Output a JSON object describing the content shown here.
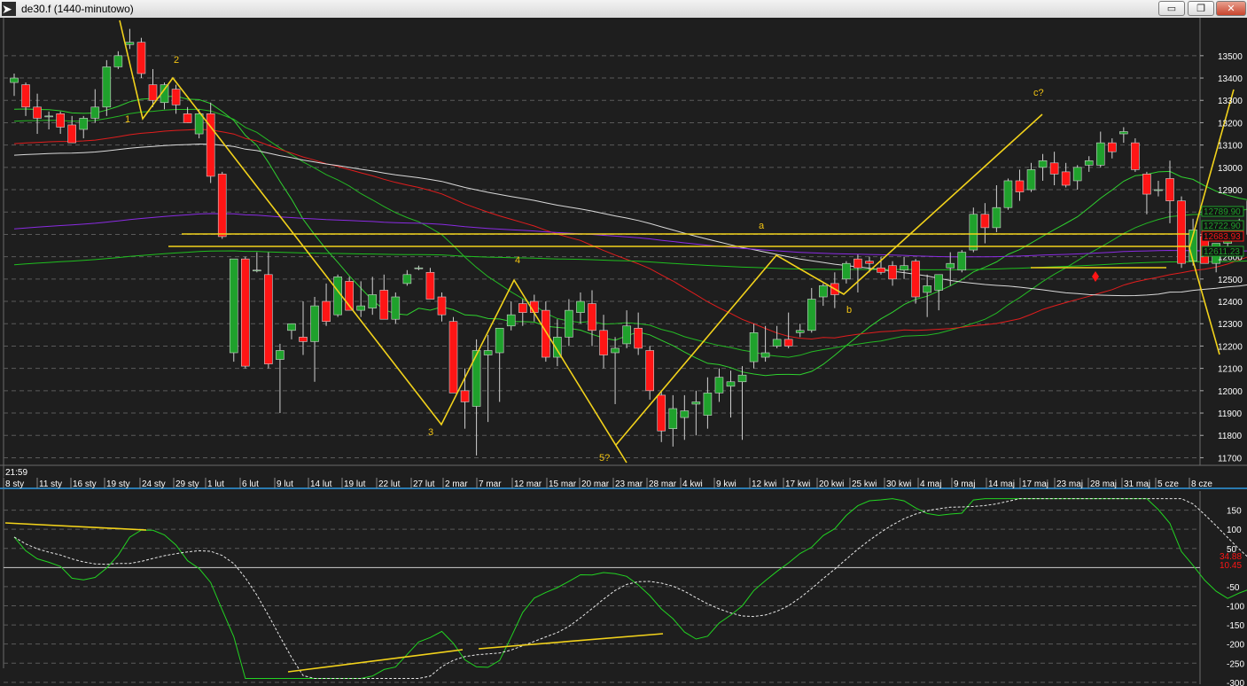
{
  "window": {
    "title": "de30.f (1440-minutowo)",
    "minimize_label": "▭",
    "restore_label": "❐",
    "close_label": "✕"
  },
  "time_label": "21:59",
  "colors": {
    "background": "#1e1e1e",
    "bull_candle": "#1fa12c",
    "bear_candle": "#ff1515",
    "annotation": "#f2d21b",
    "grid": "#5a5a5a"
  },
  "chart_data": [
    {
      "type": "candlestick",
      "symbol": "de30.f",
      "ylim": [
        11670,
        13670
      ],
      "y_ticks": [
        11700,
        11800,
        11900,
        12000,
        12100,
        12200,
        12300,
        12400,
        12500,
        12600,
        12700,
        12800,
        12900,
        13000,
        13100,
        13200,
        13300,
        13400,
        13500
      ],
      "y_tick_labels": [
        "11700",
        "11800",
        "11900",
        "12000",
        "12100",
        "12200",
        "12300",
        "12400",
        "12500",
        "12600",
        "12700",
        "12800",
        "12900",
        "13000",
        "13100",
        "13200",
        "13300",
        "13400",
        "13500"
      ],
      "x_tick_labels": [
        "8 sty",
        "11 sty",
        "16 sty",
        "19 sty",
        "24 sty",
        "29 sty",
        "1 lut",
        "6 lut",
        "9 lut",
        "14 lut",
        "19 lut",
        "22 lut",
        "27 lut",
        "2 mar",
        "7 mar",
        "12 mar",
        "15 mar",
        "20 mar",
        "23 mar",
        "28 mar",
        "4 kwi",
        "9 kwi",
        "12 kwi",
        "17 kwi",
        "20 kwi",
        "25 kwi",
        "30 kwi",
        "4 maj",
        "9 maj",
        "14 maj",
        "17 maj",
        "23 maj",
        "28 maj",
        "31 maj",
        "5 cze",
        "8 cze"
      ],
      "candles": [
        {
          "o": 13380,
          "h": 13420,
          "l": 13320,
          "c": 13400
        },
        {
          "o": 13370,
          "h": 13380,
          "l": 13230,
          "c": 13270
        },
        {
          "o": 13270,
          "h": 13330,
          "l": 13150,
          "c": 13220
        },
        {
          "o": 13230,
          "h": 13250,
          "l": 13170,
          "c": 13230
        },
        {
          "o": 13240,
          "h": 13250,
          "l": 13150,
          "c": 13180
        },
        {
          "o": 13190,
          "h": 13230,
          "l": 13110,
          "c": 13110
        },
        {
          "o": 13170,
          "h": 13230,
          "l": 13130,
          "c": 13220
        },
        {
          "o": 13220,
          "h": 13350,
          "l": 13200,
          "c": 13270
        },
        {
          "o": 13270,
          "h": 13480,
          "l": 13230,
          "c": 13450
        },
        {
          "o": 13450,
          "h": 13520,
          "l": 13440,
          "c": 13500
        },
        {
          "o": 13550,
          "h": 13620,
          "l": 13530,
          "c": 13560
        },
        {
          "o": 13560,
          "h": 13580,
          "l": 13400,
          "c": 13420
        },
        {
          "o": 13370,
          "h": 13440,
          "l": 13270,
          "c": 13300
        },
        {
          "o": 13290,
          "h": 13380,
          "l": 13260,
          "c": 13370
        },
        {
          "o": 13350,
          "h": 13370,
          "l": 13240,
          "c": 13280
        },
        {
          "o": 13240,
          "h": 13270,
          "l": 13200,
          "c": 13200
        },
        {
          "o": 13150,
          "h": 13260,
          "l": 13130,
          "c": 13240
        },
        {
          "o": 13240,
          "h": 13290,
          "l": 12930,
          "c": 12960
        },
        {
          "o": 12970,
          "h": 12980,
          "l": 12680,
          "c": 12690
        },
        {
          "o": 12170,
          "h": 12560,
          "l": 12130,
          "c": 12590
        },
        {
          "o": 12590,
          "h": 12600,
          "l": 12100,
          "c": 12110
        },
        {
          "o": 12540,
          "h": 12620,
          "l": 12530,
          "c": 12540
        },
        {
          "o": 12520,
          "h": 12620,
          "l": 12100,
          "c": 12120
        },
        {
          "o": 12140,
          "h": 12210,
          "l": 11900,
          "c": 12180
        },
        {
          "o": 12270,
          "h": 12300,
          "l": 12230,
          "c": 12300
        },
        {
          "o": 12240,
          "h": 12400,
          "l": 12160,
          "c": 12220
        },
        {
          "o": 12220,
          "h": 12420,
          "l": 12040,
          "c": 12380
        },
        {
          "o": 12400,
          "h": 12480,
          "l": 12290,
          "c": 12310
        },
        {
          "o": 12340,
          "h": 12520,
          "l": 12330,
          "c": 12510
        },
        {
          "o": 12490,
          "h": 12510,
          "l": 12380,
          "c": 12360
        },
        {
          "o": 12360,
          "h": 12490,
          "l": 12330,
          "c": 12380
        },
        {
          "o": 12370,
          "h": 12510,
          "l": 12340,
          "c": 12430
        },
        {
          "o": 12450,
          "h": 12520,
          "l": 12320,
          "c": 12320
        },
        {
          "o": 12320,
          "h": 12440,
          "l": 12300,
          "c": 12420
        },
        {
          "o": 12480,
          "h": 12540,
          "l": 12470,
          "c": 12520
        },
        {
          "o": 12550,
          "h": 12560,
          "l": 12540,
          "c": 12550
        },
        {
          "o": 12530,
          "h": 12550,
          "l": 12410,
          "c": 12410
        },
        {
          "o": 12420,
          "h": 12440,
          "l": 12310,
          "c": 12340
        },
        {
          "o": 12310,
          "h": 12330,
          "l": 11990,
          "c": 11990
        },
        {
          "o": 12000,
          "h": 12100,
          "l": 11830,
          "c": 11950
        },
        {
          "o": 11930,
          "h": 12230,
          "l": 11710,
          "c": 12180
        },
        {
          "o": 12160,
          "h": 12250,
          "l": 11860,
          "c": 12180
        },
        {
          "o": 12170,
          "h": 12280,
          "l": 11950,
          "c": 12280
        },
        {
          "o": 12290,
          "h": 12400,
          "l": 12270,
          "c": 12340
        },
        {
          "o": 12390,
          "h": 12410,
          "l": 12290,
          "c": 12350
        },
        {
          "o": 12400,
          "h": 12430,
          "l": 12310,
          "c": 12350
        },
        {
          "o": 12360,
          "h": 12400,
          "l": 12130,
          "c": 12150
        },
        {
          "o": 12150,
          "h": 12320,
          "l": 12110,
          "c": 12240
        },
        {
          "o": 12240,
          "h": 12410,
          "l": 12200,
          "c": 12360
        },
        {
          "o": 12350,
          "h": 12440,
          "l": 12300,
          "c": 12400
        },
        {
          "o": 12390,
          "h": 12450,
          "l": 12200,
          "c": 12270
        },
        {
          "o": 12270,
          "h": 12340,
          "l": 12100,
          "c": 12160
        },
        {
          "o": 12170,
          "h": 12240,
          "l": 11940,
          "c": 12190
        },
        {
          "o": 12210,
          "h": 12360,
          "l": 12190,
          "c": 12290
        },
        {
          "o": 12280,
          "h": 12350,
          "l": 12160,
          "c": 12190
        },
        {
          "o": 12180,
          "h": 12200,
          "l": 11960,
          "c": 12000
        },
        {
          "o": 11980,
          "h": 12000,
          "l": 11770,
          "c": 11820
        },
        {
          "o": 11830,
          "h": 11980,
          "l": 11750,
          "c": 11920
        },
        {
          "o": 11880,
          "h": 11980,
          "l": 11780,
          "c": 11910
        },
        {
          "o": 11940,
          "h": 12000,
          "l": 11800,
          "c": 11950
        },
        {
          "o": 11890,
          "h": 12060,
          "l": 11830,
          "c": 11990
        },
        {
          "o": 11990,
          "h": 12100,
          "l": 11950,
          "c": 12060
        },
        {
          "o": 12020,
          "h": 12090,
          "l": 11880,
          "c": 12040
        },
        {
          "o": 12040,
          "h": 12110,
          "l": 11780,
          "c": 12070
        },
        {
          "o": 12130,
          "h": 12300,
          "l": 12100,
          "c": 12260
        },
        {
          "o": 12150,
          "h": 12290,
          "l": 12130,
          "c": 12170
        },
        {
          "o": 12200,
          "h": 12290,
          "l": 12190,
          "c": 12230
        },
        {
          "o": 12230,
          "h": 12350,
          "l": 12190,
          "c": 12200
        },
        {
          "o": 12260,
          "h": 12300,
          "l": 12240,
          "c": 12270
        },
        {
          "o": 12270,
          "h": 12460,
          "l": 12260,
          "c": 12410
        },
        {
          "o": 12420,
          "h": 12480,
          "l": 12380,
          "c": 12470
        },
        {
          "o": 12480,
          "h": 12530,
          "l": 12370,
          "c": 12430
        },
        {
          "o": 12500,
          "h": 12580,
          "l": 12480,
          "c": 12570
        },
        {
          "o": 12590,
          "h": 12610,
          "l": 12440,
          "c": 12550
        },
        {
          "o": 12580,
          "h": 12600,
          "l": 12530,
          "c": 12570
        },
        {
          "o": 12550,
          "h": 12600,
          "l": 12520,
          "c": 12530
        },
        {
          "o": 12560,
          "h": 12580,
          "l": 12470,
          "c": 12500
        },
        {
          "o": 12540,
          "h": 12600,
          "l": 12500,
          "c": 12560
        },
        {
          "o": 12580,
          "h": 12590,
          "l": 12390,
          "c": 12420
        },
        {
          "o": 12440,
          "h": 12520,
          "l": 12330,
          "c": 12470
        },
        {
          "o": 12450,
          "h": 12520,
          "l": 12360,
          "c": 12520
        },
        {
          "o": 12550,
          "h": 12620,
          "l": 12470,
          "c": 12570
        },
        {
          "o": 12540,
          "h": 12630,
          "l": 12530,
          "c": 12620
        },
        {
          "o": 12630,
          "h": 12820,
          "l": 12620,
          "c": 12790
        },
        {
          "o": 12790,
          "h": 12840,
          "l": 12660,
          "c": 12730
        },
        {
          "o": 12730,
          "h": 12920,
          "l": 12710,
          "c": 12820
        },
        {
          "o": 12820,
          "h": 12950,
          "l": 12810,
          "c": 12940
        },
        {
          "o": 12940,
          "h": 12990,
          "l": 12850,
          "c": 12890
        },
        {
          "o": 12900,
          "h": 13020,
          "l": 12890,
          "c": 12990
        },
        {
          "o": 13000,
          "h": 13060,
          "l": 12940,
          "c": 13030
        },
        {
          "o": 13020,
          "h": 13070,
          "l": 12920,
          "c": 12970
        },
        {
          "o": 12980,
          "h": 13020,
          "l": 12910,
          "c": 12920
        },
        {
          "o": 12940,
          "h": 13010,
          "l": 12900,
          "c": 13000
        },
        {
          "o": 13010,
          "h": 13050,
          "l": 12980,
          "c": 13030
        },
        {
          "o": 13010,
          "h": 13160,
          "l": 13000,
          "c": 13110
        },
        {
          "o": 13110,
          "h": 13130,
          "l": 13040,
          "c": 13070
        },
        {
          "o": 13150,
          "h": 13180,
          "l": 13110,
          "c": 13160
        },
        {
          "o": 13110,
          "h": 13130,
          "l": 12980,
          "c": 12990
        },
        {
          "o": 12970,
          "h": 12980,
          "l": 12790,
          "c": 12880
        },
        {
          "o": 12900,
          "h": 12940,
          "l": 12870,
          "c": 12900
        },
        {
          "o": 12950,
          "h": 13030,
          "l": 12750,
          "c": 12850
        },
        {
          "o": 12850,
          "h": 12870,
          "l": 12550,
          "c": 12570
        },
        {
          "o": 12580,
          "h": 12770,
          "l": 12560,
          "c": 12720
        },
        {
          "o": 12690,
          "h": 12720,
          "l": 12570,
          "c": 12570
        },
        {
          "o": 12570,
          "h": 12630,
          "l": 12530,
          "c": 12660
        },
        {
          "o": 12660,
          "h": 12750,
          "l": 12630,
          "c": 12700
        },
        {
          "o": 12720,
          "h": 12770,
          "l": 12700,
          "c": 12720
        },
        {
          "o": 12700,
          "h": 12910,
          "l": 12680,
          "c": 12850
        },
        {
          "o": 12860,
          "h": 12870,
          "l": 12610,
          "c": 12690
        },
        {
          "o": 12630,
          "h": 12760,
          "l": 12620,
          "c": 12720
        }
      ],
      "price_labels": [
        {
          "value": "12789.90",
          "color": "#1fa12c"
        },
        {
          "value": "12722.90",
          "color": "#1fa12c"
        },
        {
          "value": "12683.93",
          "color": "#ff1515"
        },
        {
          "value": "12611.23",
          "color": "#1fa12c"
        }
      ],
      "wave_annotations": [
        "1",
        "2",
        "3",
        "4",
        "5?",
        "a",
        "b",
        "c?"
      ]
    },
    {
      "type": "line",
      "name": "oscillator",
      "ylim": [
        -305,
        200
      ],
      "y_ticks": [
        150,
        100,
        50,
        -50,
        -100,
        -150,
        -200,
        -250,
        -300
      ],
      "y_tick_labels": [
        "150",
        "100",
        "50",
        "-50",
        "-100",
        "-150",
        "-200",
        "-250",
        "-300"
      ],
      "current_values": [
        {
          "value": "34.88",
          "color": "#ff1515"
        },
        {
          "value": "10.45",
          "color": "#ff1515"
        }
      ]
    }
  ]
}
